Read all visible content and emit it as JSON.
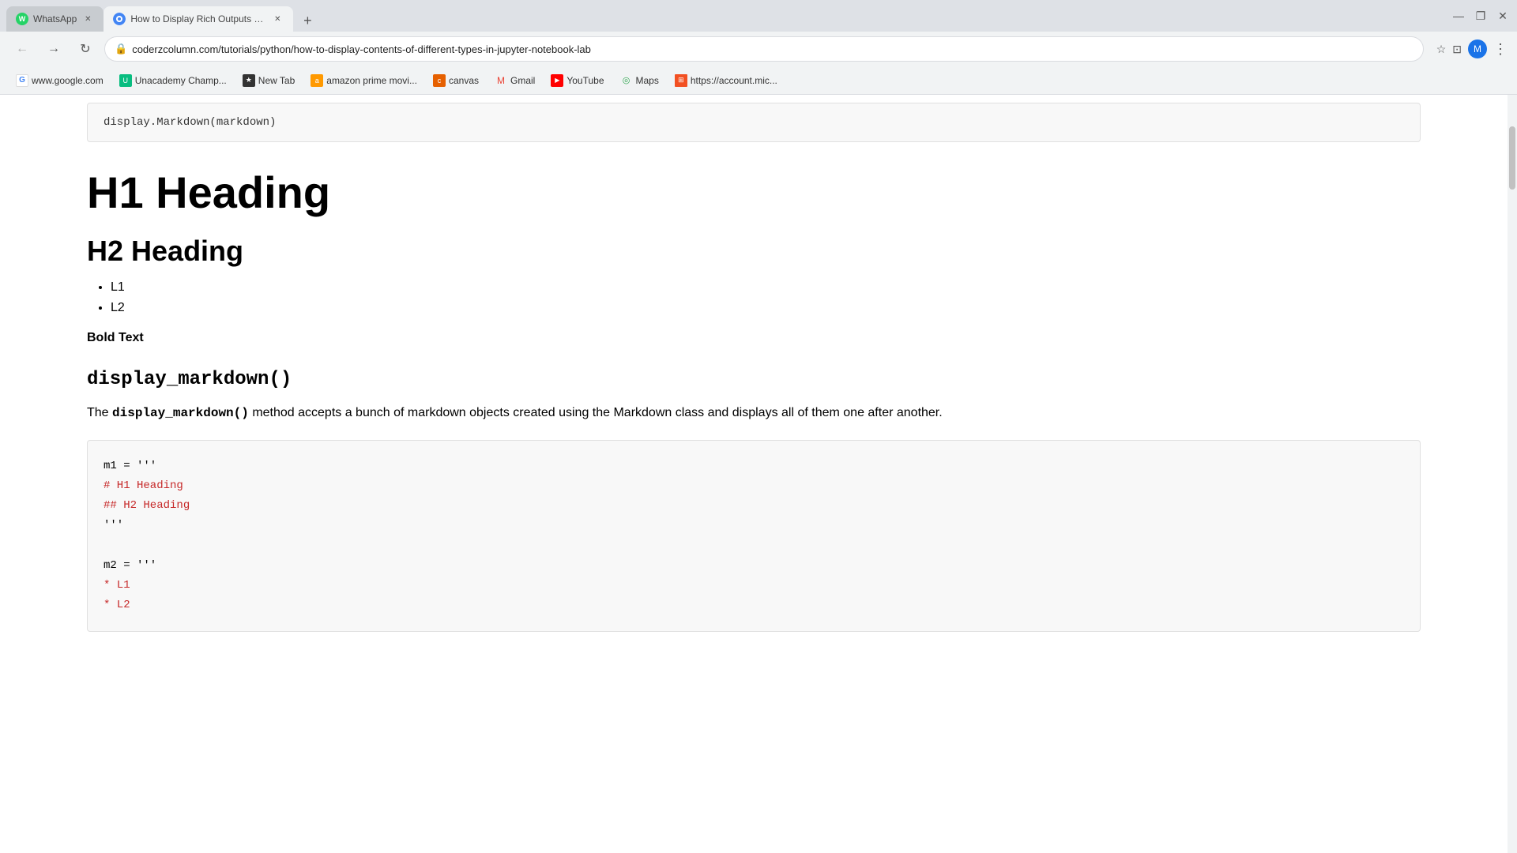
{
  "browser": {
    "tabs": [
      {
        "id": "whatsapp-tab",
        "title": "WhatsApp",
        "favicon": "WA",
        "favicon_class": "whatsapp-favicon",
        "active": false
      },
      {
        "id": "coderzcolumn-tab",
        "title": "How to Display Rich Outputs (im...",
        "favicon": "●",
        "favicon_class": "chromefav",
        "active": true
      }
    ],
    "new_tab_icon": "+",
    "address": "coderzcolumn.com/tutorials/python/how-to-display-contents-of-different-types-in-jupyter-notebook-lab",
    "window_controls": [
      "—",
      "❐",
      "✕"
    ],
    "bookmarks": [
      {
        "label": "www.google.com",
        "icon": "G",
        "icon_class": "bm-google"
      },
      {
        "label": "Unacademy Champ...",
        "icon": "U",
        "icon_class": "bm-unacademy"
      },
      {
        "label": "New Tab",
        "icon": "★",
        "icon_class": "bm-newtab"
      },
      {
        "label": "amazon prime movi...",
        "icon": "a",
        "icon_class": "bm-amazon"
      },
      {
        "label": "canvas",
        "icon": "c",
        "icon_class": "bm-canvas"
      },
      {
        "label": "Gmail",
        "icon": "M",
        "icon_class": "bm-gmail"
      },
      {
        "label": "YouTube",
        "icon": "▶",
        "icon_class": "bm-youtube"
      },
      {
        "label": "Maps",
        "icon": "◎",
        "icon_class": "bm-maps"
      },
      {
        "label": "https://account.mic...",
        "icon": "⊞",
        "icon_class": "bm-ms"
      }
    ]
  },
  "page": {
    "code_top": "display.Markdown(markdown)",
    "h1": "H1 Heading",
    "h2": "H2 Heading",
    "list_items": [
      "L1",
      "L2"
    ],
    "bold_text": "Bold Text",
    "section_title": "display_markdown()",
    "paragraph_before": "The",
    "paragraph_inline_code": "display_markdown()",
    "paragraph_after": "method accepts a bunch of markdown objects created using the Markdown class and displays all of them one after another.",
    "code_block_lines": [
      {
        "text": "m1 = '''",
        "color": "black"
      },
      {
        "text": "# H1 Heading",
        "color": "red"
      },
      {
        "text": "## H2 Heading",
        "color": "red"
      },
      {
        "text": "'''",
        "color": "black"
      },
      {
        "text": "",
        "color": "black"
      },
      {
        "text": "m2 = '''",
        "color": "black"
      },
      {
        "text": "* L1",
        "color": "red"
      },
      {
        "text": "* L2",
        "color": "red"
      }
    ]
  }
}
